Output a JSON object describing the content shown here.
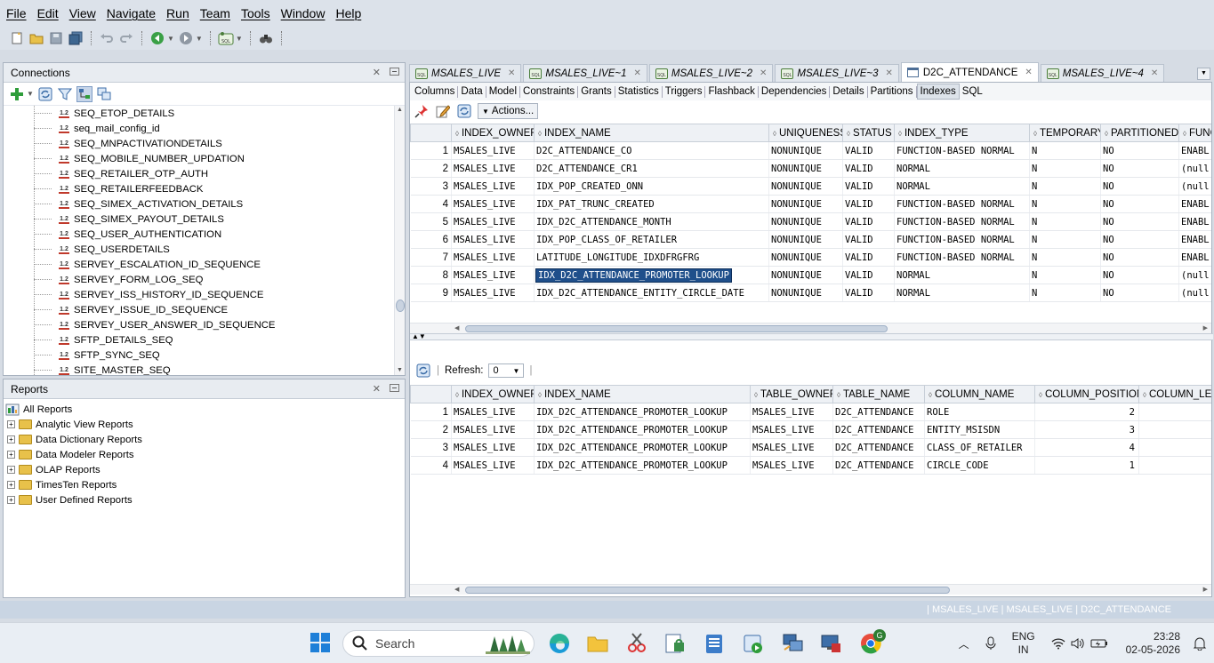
{
  "menu": [
    "File",
    "Edit",
    "View",
    "Navigate",
    "Run",
    "Team",
    "Tools",
    "Window",
    "Help"
  ],
  "connections": {
    "title": "Connections",
    "items": [
      "SEQ_ETOP_DETAILS",
      "seq_mail_config_id",
      "SEQ_MNPACTIVATIONDETAILS",
      "SEQ_MOBILE_NUMBER_UPDATION",
      "SEQ_RETAILER_OTP_AUTH",
      "SEQ_RETAILERFEEDBACK",
      "SEQ_SIMEX_ACTIVATION_DETAILS",
      "SEQ_SIMEX_PAYOUT_DETAILS",
      "SEQ_USER_AUTHENTICATION",
      "SEQ_USERDETAILS",
      "SERVEY_ESCALATION_ID_SEQUENCE",
      "SERVEY_FORM_LOG_SEQ",
      "SERVEY_ISS_HISTORY_ID_SEQUENCE",
      "SERVEY_ISSUE_ID_SEQUENCE",
      "SERVEY_USER_ANSWER_ID_SEQUENCE",
      "SFTP_DETAILS_SEQ",
      "SFTP_SYNC_SEQ",
      "SITE_MASTER_SEQ"
    ]
  },
  "reports": {
    "title": "Reports",
    "root": "All Reports",
    "items": [
      "Analytic View Reports",
      "Data Dictionary Reports",
      "Data Modeler Reports",
      "OLAP Reports",
      "TimesTen Reports",
      "User Defined Reports"
    ]
  },
  "doc_tabs": [
    "MSALES_LIVE",
    "MSALES_LIVE~1",
    "MSALES_LIVE~2",
    "MSALES_LIVE~3",
    "D2C_ATTENDANCE",
    "MSALES_LIVE~4"
  ],
  "sub_tabs": [
    "Columns",
    "Data",
    "Model",
    "Constraints",
    "Grants",
    "Statistics",
    "Triggers",
    "Flashback",
    "Dependencies",
    "Details",
    "Partitions",
    "Indexes",
    "SQL"
  ],
  "actions_label": "Actions...",
  "upper_grid": {
    "headers": [
      "INDEX_OWNER",
      "INDEX_NAME",
      "UNIQUENESS",
      "STATUS",
      "INDEX_TYPE",
      "TEMPORARY",
      "PARTITIONED",
      "FUNC"
    ],
    "rows": [
      [
        "1",
        "MSALES_LIVE",
        "D2C_ATTENDANCE_CO",
        "NONUNIQUE",
        "VALID",
        "FUNCTION-BASED NORMAL",
        "N",
        "NO",
        "ENABL"
      ],
      [
        "2",
        "MSALES_LIVE",
        "D2C_ATTENDANCE_CR1",
        "NONUNIQUE",
        "VALID",
        "NORMAL",
        "N",
        "NO",
        "(null"
      ],
      [
        "3",
        "MSALES_LIVE",
        "IDX_POP_CREATED_ONN",
        "NONUNIQUE",
        "VALID",
        "NORMAL",
        "N",
        "NO",
        "(null"
      ],
      [
        "4",
        "MSALES_LIVE",
        "IDX_PAT_TRUNC_CREATED",
        "NONUNIQUE",
        "VALID",
        "FUNCTION-BASED NORMAL",
        "N",
        "NO",
        "ENABL"
      ],
      [
        "5",
        "MSALES_LIVE",
        "IDX_D2C_ATTENDANCE_MONTH",
        "NONUNIQUE",
        "VALID",
        "FUNCTION-BASED NORMAL",
        "N",
        "NO",
        "ENABL"
      ],
      [
        "6",
        "MSALES_LIVE",
        "IDX_POP_CLASS_OF_RETAILER",
        "NONUNIQUE",
        "VALID",
        "FUNCTION-BASED NORMAL",
        "N",
        "NO",
        "ENABL"
      ],
      [
        "7",
        "MSALES_LIVE",
        "LATITUDE_LONGITUDE_IDXDFRGFRG",
        "NONUNIQUE",
        "VALID",
        "FUNCTION-BASED NORMAL",
        "N",
        "NO",
        "ENABL"
      ],
      [
        "8",
        "MSALES_LIVE",
        "IDX_D2C_ATTENDANCE_PROMOTER_LOOKUP",
        "NONUNIQUE",
        "VALID",
        "NORMAL",
        "N",
        "NO",
        "(null"
      ],
      [
        "9",
        "MSALES_LIVE",
        "IDX_D2C_ATTENDANCE_ENTITY_CIRCLE_DATE",
        "NONUNIQUE",
        "VALID",
        "NORMAL",
        "N",
        "NO",
        "(null"
      ]
    ]
  },
  "lower": {
    "refresh_label": "Refresh:",
    "refresh_value": "0",
    "headers": [
      "INDEX_OWNER",
      "INDEX_NAME",
      "TABLE_OWNER",
      "TABLE_NAME",
      "COLUMN_NAME",
      "COLUMN_POSITION",
      "COLUMN_LEN"
    ],
    "rows": [
      [
        "1",
        "MSALES_LIVE",
        "IDX_D2C_ATTENDANCE_PROMOTER_LOOKUP",
        "MSALES_LIVE",
        "D2C_ATTENDANCE",
        "ROLE",
        "2",
        ""
      ],
      [
        "2",
        "MSALES_LIVE",
        "IDX_D2C_ATTENDANCE_PROMOTER_LOOKUP",
        "MSALES_LIVE",
        "D2C_ATTENDANCE",
        "ENTITY_MSISDN",
        "3",
        ""
      ],
      [
        "3",
        "MSALES_LIVE",
        "IDX_D2C_ATTENDANCE_PROMOTER_LOOKUP",
        "MSALES_LIVE",
        "D2C_ATTENDANCE",
        "CLASS_OF_RETAILER",
        "4",
        ""
      ],
      [
        "4",
        "MSALES_LIVE",
        "IDX_D2C_ATTENDANCE_PROMOTER_LOOKUP",
        "MSALES_LIVE",
        "D2C_ATTENDANCE",
        "CIRCLE_CODE",
        "1",
        ""
      ]
    ]
  },
  "status_text": "| MSALES_LIVE | MSALES_LIVE | D2C_ATTENDANCE",
  "taskbar": {
    "search_placeholder": "Search",
    "lang_top": "ENG",
    "lang_bottom": "IN",
    "time": "23:28",
    "date": "02-05-2026",
    "chrome_badge": "G"
  },
  "colors": {
    "selection": "#1f4f8b",
    "accent": "#2a6fbf"
  }
}
